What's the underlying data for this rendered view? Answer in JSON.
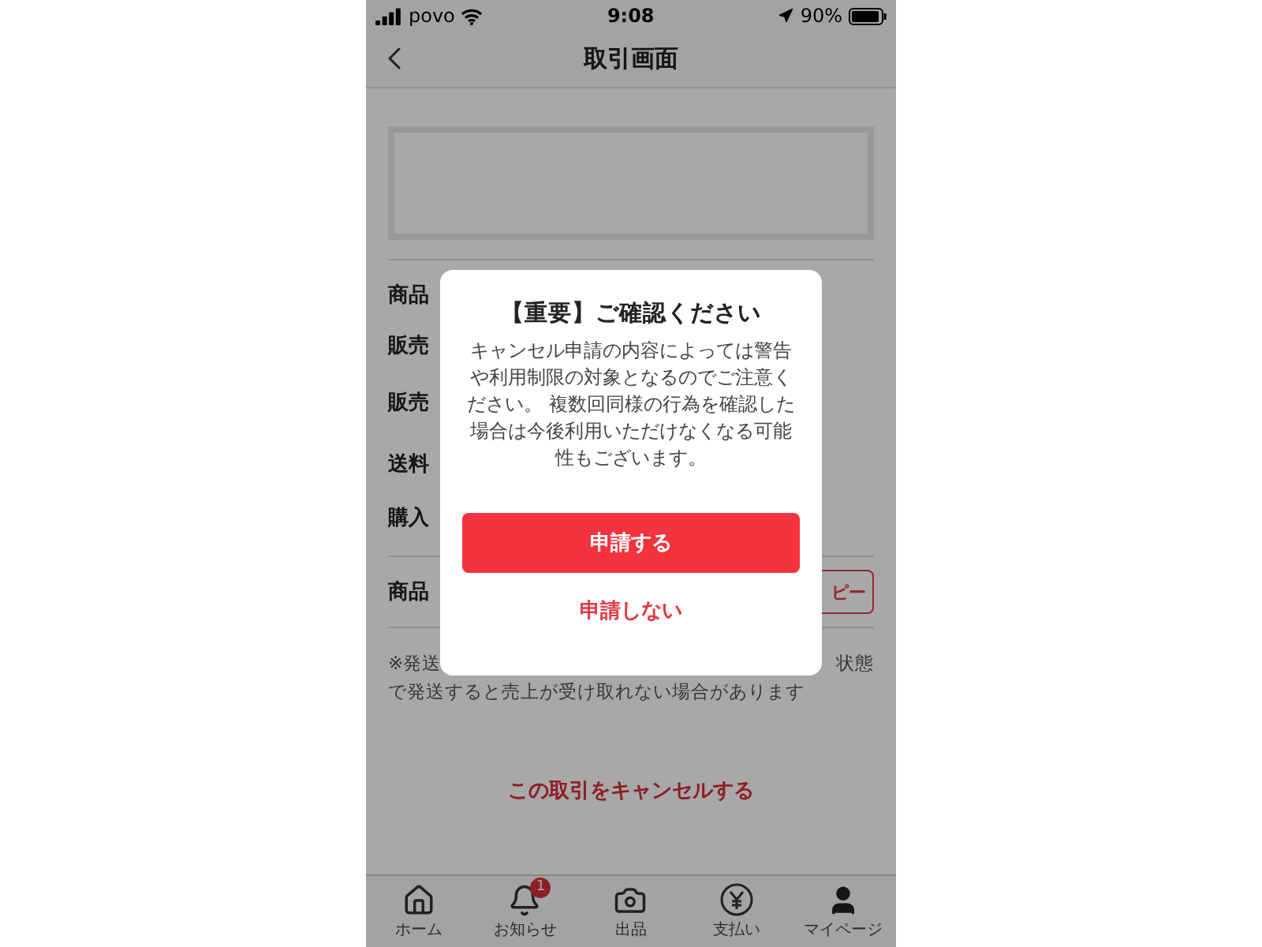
{
  "status_bar": {
    "carrier": "povo",
    "time": "9:08",
    "battery": "90%"
  },
  "header": {
    "title": "取引画面"
  },
  "details": [
    {
      "label": "商品"
    },
    {
      "label": "販売"
    },
    {
      "label": "販売"
    },
    {
      "label": "送料"
    },
    {
      "label": "購入"
    }
  ],
  "item_id": {
    "label": "商品",
    "copy_button": "ピー"
  },
  "note": {
    "line_1_left": "※発送",
    "line_1_right": "状態",
    "line_2": "で発送すると売上が受け取れない場合があります"
  },
  "cancel_link": "この取引をキャンセルする",
  "tab_bar": [
    {
      "label": "ホーム",
      "kind": "home"
    },
    {
      "label": "お知らせ",
      "kind": "bell",
      "badge": "1"
    },
    {
      "label": "出品",
      "kind": "camera"
    },
    {
      "label": "支払い",
      "kind": "yen"
    },
    {
      "label": "マイページ",
      "kind": "user"
    }
  ],
  "dialog": {
    "title": "【重要】ご確認ください",
    "message": "キャンセル申請の内容によっては警告や利用制限の対象となるのでご注意ください。 複数回同様の行為を確認した場合は今後利用いただけなくなる可能性もございます。",
    "primary_button": "申請する",
    "secondary_button": "申請しない"
  }
}
